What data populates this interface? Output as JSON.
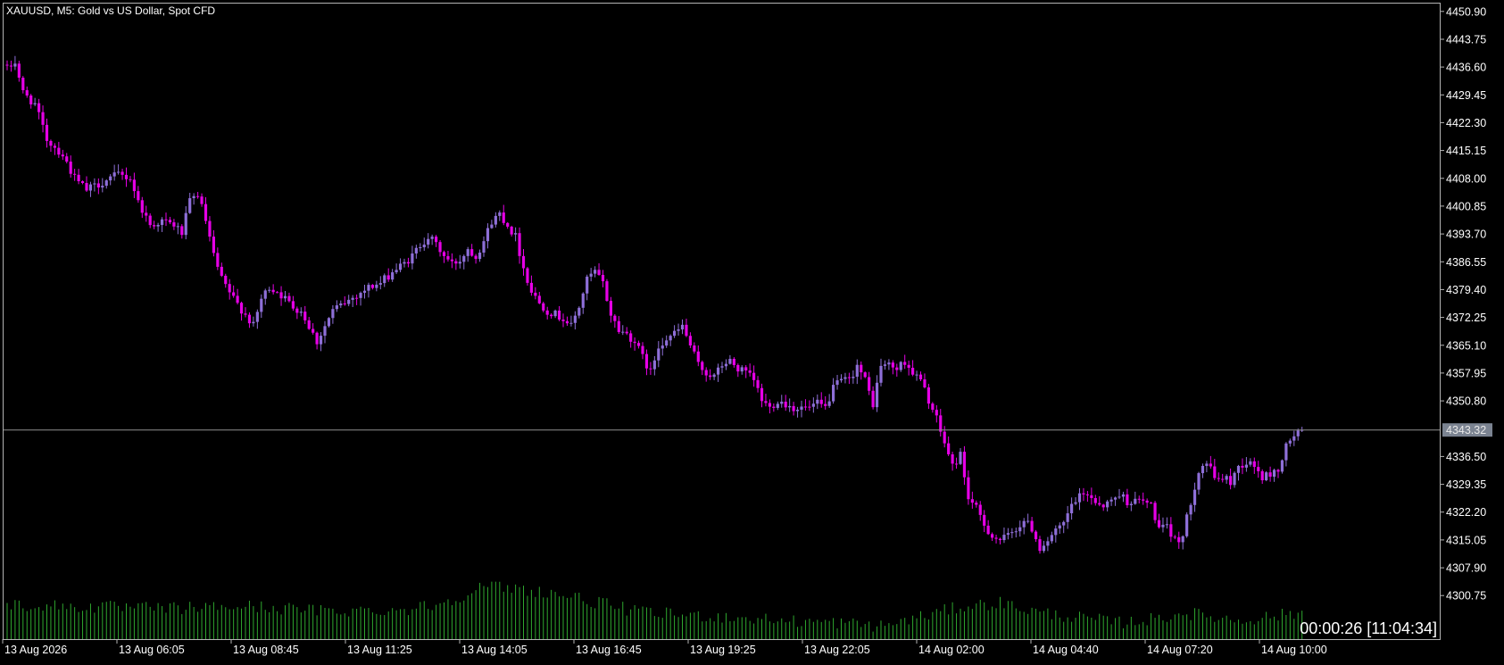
{
  "chart_data": {
    "type": "candlestick",
    "title": "XAUUSD, M5:  Gold vs US Dollar, Spot CFD",
    "ylim": [
      4296.9,
      4452.0
    ],
    "y_ticks": [
      "4450.90",
      "4443.75",
      "4436.60",
      "4429.45",
      "4422.30",
      "4415.15",
      "4408.00",
      "4400.85",
      "4393.70",
      "4386.55",
      "4379.40",
      "4372.25",
      "4365.10",
      "4357.95",
      "4350.80",
      "4336.50",
      "4329.35",
      "4322.20",
      "4315.05",
      "4307.90",
      "4300.75"
    ],
    "current_price": "4343.32",
    "x_ticks": [
      "13 Aug 2026",
      "13 Aug 06:05",
      "13 Aug 08:45",
      "13 Aug 11:25",
      "13 Aug 14:05",
      "13 Aug 16:45",
      "13 Aug 19:25",
      "13 Aug 22:05",
      "14 Aug 02:00",
      "14 Aug 04:40",
      "14 Aug 07:20",
      "14 Aug 10:00"
    ],
    "timer": "00:00:26 [11:04:34]",
    "colors": {
      "background": "#000000",
      "frame": "#b4b4b4",
      "text": "#ffffff",
      "bear": "#e600e6",
      "bull": "#8e6fd8",
      "volume": "#2fa82f",
      "price_line": "#8f8f8f",
      "price_label_bg": "#7b8391"
    },
    "close_path": [
      [
        0,
        4436
      ],
      [
        2,
        4438
      ],
      [
        4,
        4430
      ],
      [
        7,
        4427
      ],
      [
        10,
        4418
      ],
      [
        14,
        4414
      ],
      [
        17,
        4408
      ],
      [
        20,
        4405
      ],
      [
        24,
        4407
      ],
      [
        28,
        4409
      ],
      [
        31,
        4408
      ],
      [
        33,
        4402
      ],
      [
        36,
        4396
      ],
      [
        39,
        4397
      ],
      [
        42,
        4396
      ],
      [
        44,
        4394
      ],
      [
        46,
        4402
      ],
      [
        48,
        4404
      ],
      [
        50,
        4397
      ],
      [
        52,
        4388
      ],
      [
        54,
        4382
      ],
      [
        57,
        4377
      ],
      [
        60,
        4373
      ],
      [
        62,
        4370
      ],
      [
        64,
        4377
      ],
      [
        66,
        4380
      ],
      [
        68,
        4379
      ],
      [
        70,
        4377
      ],
      [
        72,
        4375
      ],
      [
        74,
        4374
      ],
      [
        76,
        4370
      ],
      [
        78,
        4366
      ],
      [
        80,
        4370
      ],
      [
        82,
        4374
      ],
      [
        85,
        4376
      ],
      [
        88,
        4378
      ],
      [
        91,
        4380
      ],
      [
        94,
        4381
      ],
      [
        97,
        4384
      ],
      [
        100,
        4386
      ],
      [
        102,
        4388
      ],
      [
        104,
        4391
      ],
      [
        106,
        4393
      ],
      [
        108,
        4391
      ],
      [
        110,
        4388
      ],
      [
        112,
        4386
      ],
      [
        114,
        4387
      ],
      [
        116,
        4390
      ],
      [
        118,
        4388
      ],
      [
        120,
        4392
      ],
      [
        122,
        4397
      ],
      [
        124,
        4399
      ],
      [
        126,
        4396
      ],
      [
        128,
        4393
      ],
      [
        130,
        4385
      ],
      [
        132,
        4379
      ],
      [
        134,
        4376
      ],
      [
        136,
        4374
      ],
      [
        138,
        4373
      ],
      [
        140,
        4372
      ],
      [
        142,
        4370
      ],
      [
        144,
        4375
      ],
      [
        146,
        4382
      ],
      [
        148,
        4384
      ],
      [
        150,
        4381
      ],
      [
        152,
        4373
      ],
      [
        154,
        4369
      ],
      [
        156,
        4368
      ],
      [
        158,
        4366
      ],
      [
        160,
        4362
      ],
      [
        162,
        4358
      ],
      [
        164,
        4365
      ],
      [
        166,
        4367
      ],
      [
        168,
        4368
      ],
      [
        170,
        4370
      ],
      [
        172,
        4365
      ],
      [
        174,
        4360
      ],
      [
        176,
        4358
      ],
      [
        178,
        4357
      ],
      [
        180,
        4360
      ],
      [
        182,
        4361
      ],
      [
        184,
        4359
      ],
      [
        186,
        4358
      ],
      [
        188,
        4356
      ],
      [
        190,
        4351
      ],
      [
        192,
        4349
      ],
      [
        194,
        4351
      ],
      [
        196,
        4350
      ],
      [
        198,
        4349
      ],
      [
        200,
        4349
      ],
      [
        202,
        4349
      ],
      [
        204,
        4350
      ],
      [
        206,
        4349
      ],
      [
        208,
        4354
      ],
      [
        210,
        4356
      ],
      [
        212,
        4356
      ],
      [
        214,
        4360
      ],
      [
        216,
        4356
      ],
      [
        218,
        4350
      ],
      [
        220,
        4360
      ],
      [
        222,
        4360
      ],
      [
        224,
        4359
      ],
      [
        226,
        4361
      ],
      [
        228,
        4358
      ],
      [
        230,
        4356
      ],
      [
        232,
        4351
      ],
      [
        234,
        4346
      ],
      [
        236,
        4340
      ],
      [
        238,
        4334
      ],
      [
        240,
        4337
      ],
      [
        242,
        4326
      ],
      [
        244,
        4323
      ],
      [
        246,
        4319
      ],
      [
        248,
        4316
      ],
      [
        250,
        4315
      ],
      [
        252,
        4316
      ],
      [
        254,
        4318
      ],
      [
        256,
        4320
      ],
      [
        258,
        4318
      ],
      [
        260,
        4313
      ],
      [
        262,
        4315
      ],
      [
        264,
        4317
      ],
      [
        266,
        4319
      ],
      [
        268,
        4324
      ],
      [
        270,
        4326
      ],
      [
        272,
        4327
      ],
      [
        274,
        4325
      ],
      [
        276,
        4324
      ],
      [
        278,
        4325
      ],
      [
        280,
        4327
      ],
      [
        282,
        4325
      ],
      [
        284,
        4325
      ],
      [
        286,
        4325
      ],
      [
        288,
        4324
      ],
      [
        290,
        4318
      ],
      [
        292,
        4318
      ],
      [
        294,
        4315
      ],
      [
        296,
        4316
      ],
      [
        298,
        4325
      ],
      [
        300,
        4333
      ],
      [
        302,
        4335
      ],
      [
        304,
        4331
      ],
      [
        306,
        4331
      ],
      [
        308,
        4330
      ],
      [
        310,
        4334
      ],
      [
        312,
        4335
      ],
      [
        314,
        4334
      ],
      [
        316,
        4331
      ],
      [
        318,
        4332
      ],
      [
        320,
        4333
      ],
      [
        322,
        4339
      ],
      [
        324,
        4342
      ],
      [
        326,
        4343.32
      ]
    ],
    "volume_profile": [
      [
        0,
        0.58
      ],
      [
        20,
        0.55
      ],
      [
        40,
        0.52
      ],
      [
        60,
        0.56
      ],
      [
        80,
        0.48
      ],
      [
        100,
        0.5
      ],
      [
        110,
        0.62
      ],
      [
        120,
        0.9
      ],
      [
        130,
        0.85
      ],
      [
        140,
        0.75
      ],
      [
        160,
        0.45
      ],
      [
        180,
        0.38
      ],
      [
        200,
        0.3
      ],
      [
        210,
        0.28
      ],
      [
        220,
        0.22
      ],
      [
        230,
        0.38
      ],
      [
        240,
        0.55
      ],
      [
        250,
        0.62
      ],
      [
        260,
        0.45
      ],
      [
        280,
        0.28
      ],
      [
        290,
        0.35
      ],
      [
        296,
        0.45
      ],
      [
        310,
        0.32
      ],
      [
        326,
        0.45
      ]
    ]
  }
}
